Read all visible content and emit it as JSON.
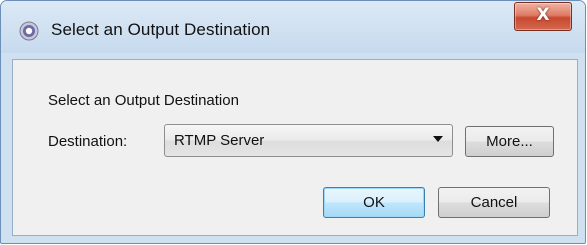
{
  "window": {
    "title": "Select an Output Destination",
    "close_label": "X",
    "icon": "app-circle-icon",
    "colors": {
      "frame": "#cfe0f1",
      "close_button": "#c9482f",
      "default_button_border": "#3c7fb1"
    }
  },
  "dialog": {
    "section_label": "Select an Output Destination",
    "destination_label": "Destination:",
    "destination_value": "RTMP Server",
    "more_label": "More...",
    "ok_label": "OK",
    "cancel_label": "Cancel"
  }
}
